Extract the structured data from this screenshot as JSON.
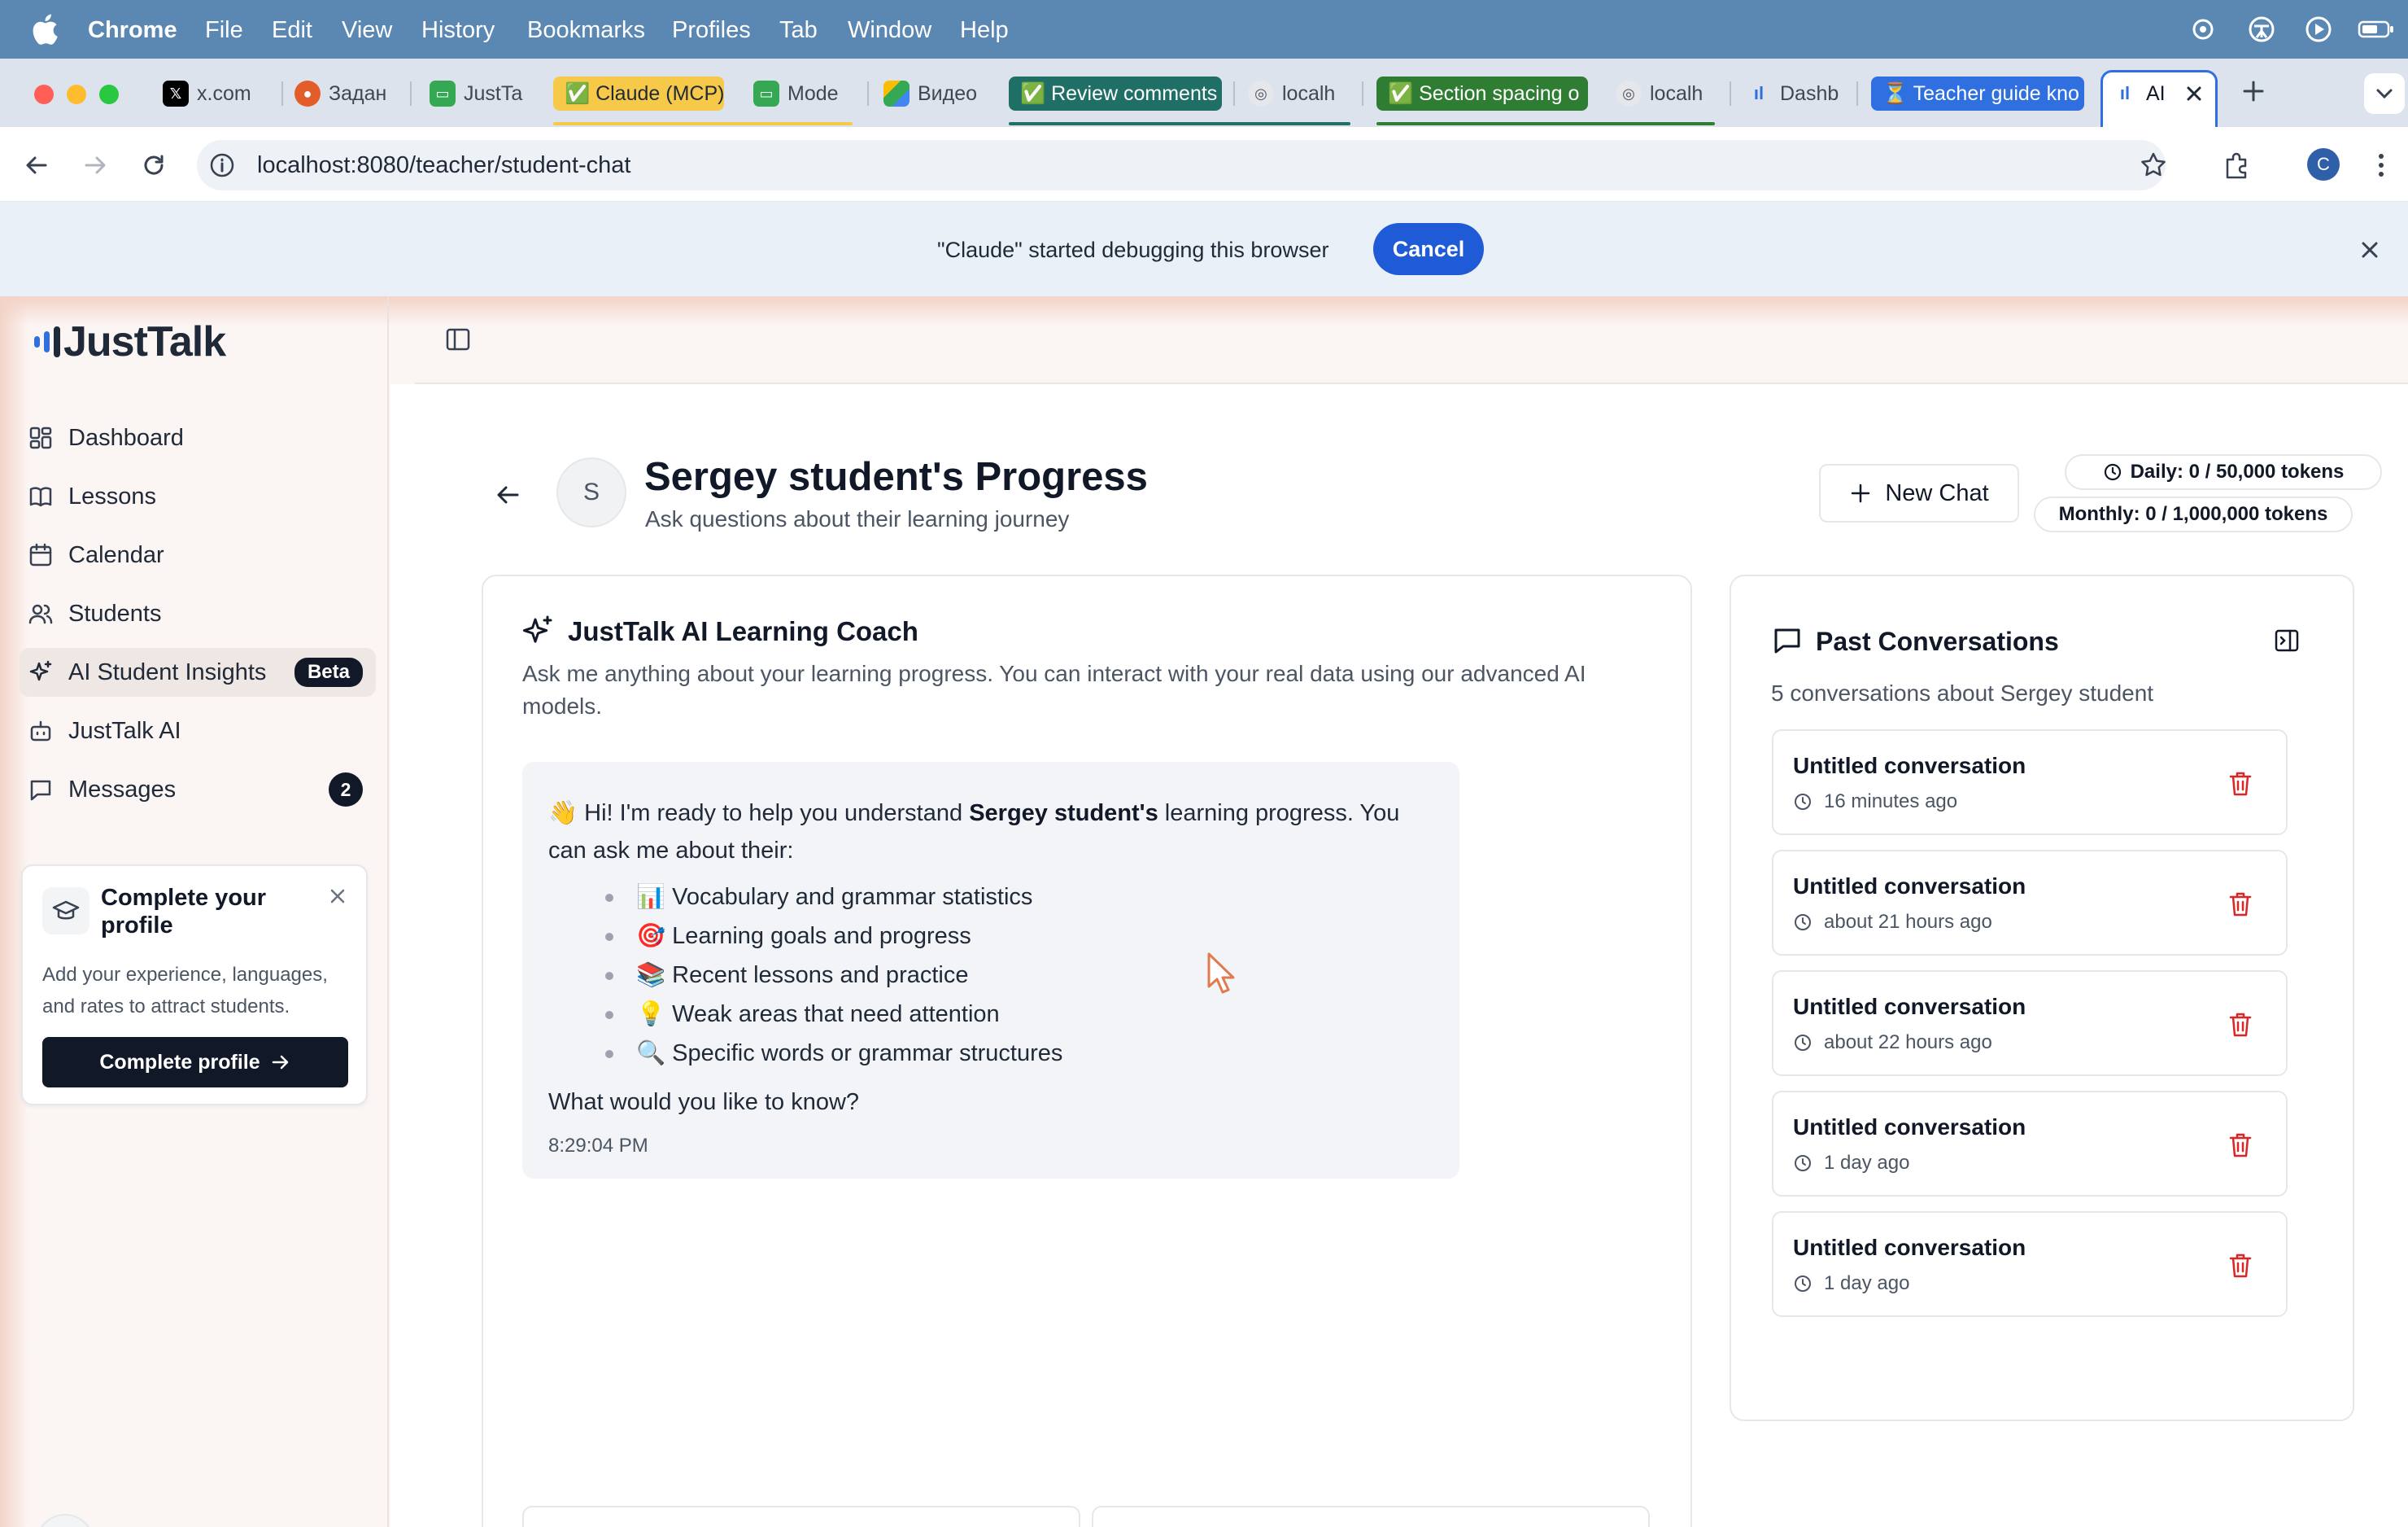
{
  "menubar": {
    "app": "Chrome",
    "items": [
      "File",
      "Edit",
      "View",
      "History",
      "Bookmarks",
      "Profiles",
      "Tab",
      "Window",
      "Help"
    ]
  },
  "tabs": [
    {
      "label": "x.com",
      "icon": "x-logo-icon"
    },
    {
      "label": "Задан",
      "icon": "task-icon"
    },
    {
      "label": "JustTa",
      "icon": "slides-icon"
    },
    {
      "label": "✅ Claude (MCP)",
      "icon": "",
      "group_color": "#f7c948"
    },
    {
      "label": "Mode",
      "icon": "slides-icon"
    },
    {
      "label": "Видео",
      "icon": "drive-icon"
    },
    {
      "label": "✅ Review comments",
      "icon": "",
      "group_color": "#1f6f67"
    },
    {
      "label": "localh",
      "icon": "globe-icon"
    },
    {
      "label": "✅ Section spacing o",
      "icon": "",
      "group_color": "#2e7d32"
    },
    {
      "label": "localh",
      "icon": "globe-icon"
    },
    {
      "label": "Dashb",
      "icon": "justtalk-icon"
    },
    {
      "label": "⏳ Teacher guide kno",
      "icon": "",
      "group_color": "#2f6fe0"
    },
    {
      "label": "AI",
      "icon": "justtalk-icon"
    }
  ],
  "address": {
    "url": "localhost:8080/teacher/student-chat"
  },
  "infobar": {
    "message": "\"Claude\" started debugging this browser",
    "cancel": "Cancel"
  },
  "sidebar": {
    "logo": "JustTalk",
    "items": [
      {
        "label": "Dashboard",
        "icon": "dashboard-icon"
      },
      {
        "label": "Lessons",
        "icon": "book-icon"
      },
      {
        "label": "Calendar",
        "icon": "calendar-icon"
      },
      {
        "label": "Students",
        "icon": "users-icon"
      },
      {
        "label": "AI Student Insights",
        "icon": "sparkles-icon",
        "badge": "Beta",
        "active": true
      },
      {
        "label": "JustTalk AI",
        "icon": "bot-icon"
      },
      {
        "label": "Messages",
        "icon": "message-icon",
        "count": "2"
      }
    ],
    "profile_card": {
      "title": "Complete your profile",
      "description": "Add your experience, languages, and rates to attract students.",
      "cta": "Complete profile"
    }
  },
  "header": {
    "avatar_initial": "S",
    "title": "Sergey student's Progress",
    "subtitle": "Ask questions about their learning journey",
    "new_chat": "New Chat",
    "daily_tokens": "Daily: 0 / 50,000 tokens",
    "monthly_tokens": "Monthly: 0 / 1,000,000 tokens"
  },
  "coach": {
    "title": "JustTalk AI Learning Coach",
    "description": "Ask me anything about your learning progress. You can interact with your real data using our advanced AI models."
  },
  "message": {
    "intro_before": "👋 Hi! I'm ready to help you understand ",
    "intro_bold": "Sergey student's",
    "intro_after": " learning progress. You can ask me about their:",
    "bullets": [
      "📊 Vocabulary and grammar statistics",
      "🎯 Learning goals and progress",
      "📚 Recent lessons and practice",
      "💡 Weak areas that need attention",
      "🔍 Specific words or grammar structures"
    ],
    "question": "What would you like to know?",
    "time": "8:29:04 PM"
  },
  "past": {
    "title": "Past Conversations",
    "subtitle": "5 conversations about Sergey student",
    "conversations": [
      {
        "title": "Untitled conversation",
        "time": "16 minutes ago"
      },
      {
        "title": "Untitled conversation",
        "time": "about 21 hours ago"
      },
      {
        "title": "Untitled conversation",
        "time": "about 22 hours ago"
      },
      {
        "title": "Untitled conversation",
        "time": "1 day ago"
      },
      {
        "title": "Untitled conversation",
        "time": "1 day ago"
      }
    ]
  },
  "colors": {
    "accent": "#2f6fe0",
    "danger": "#dc2626",
    "dark": "#111827"
  }
}
